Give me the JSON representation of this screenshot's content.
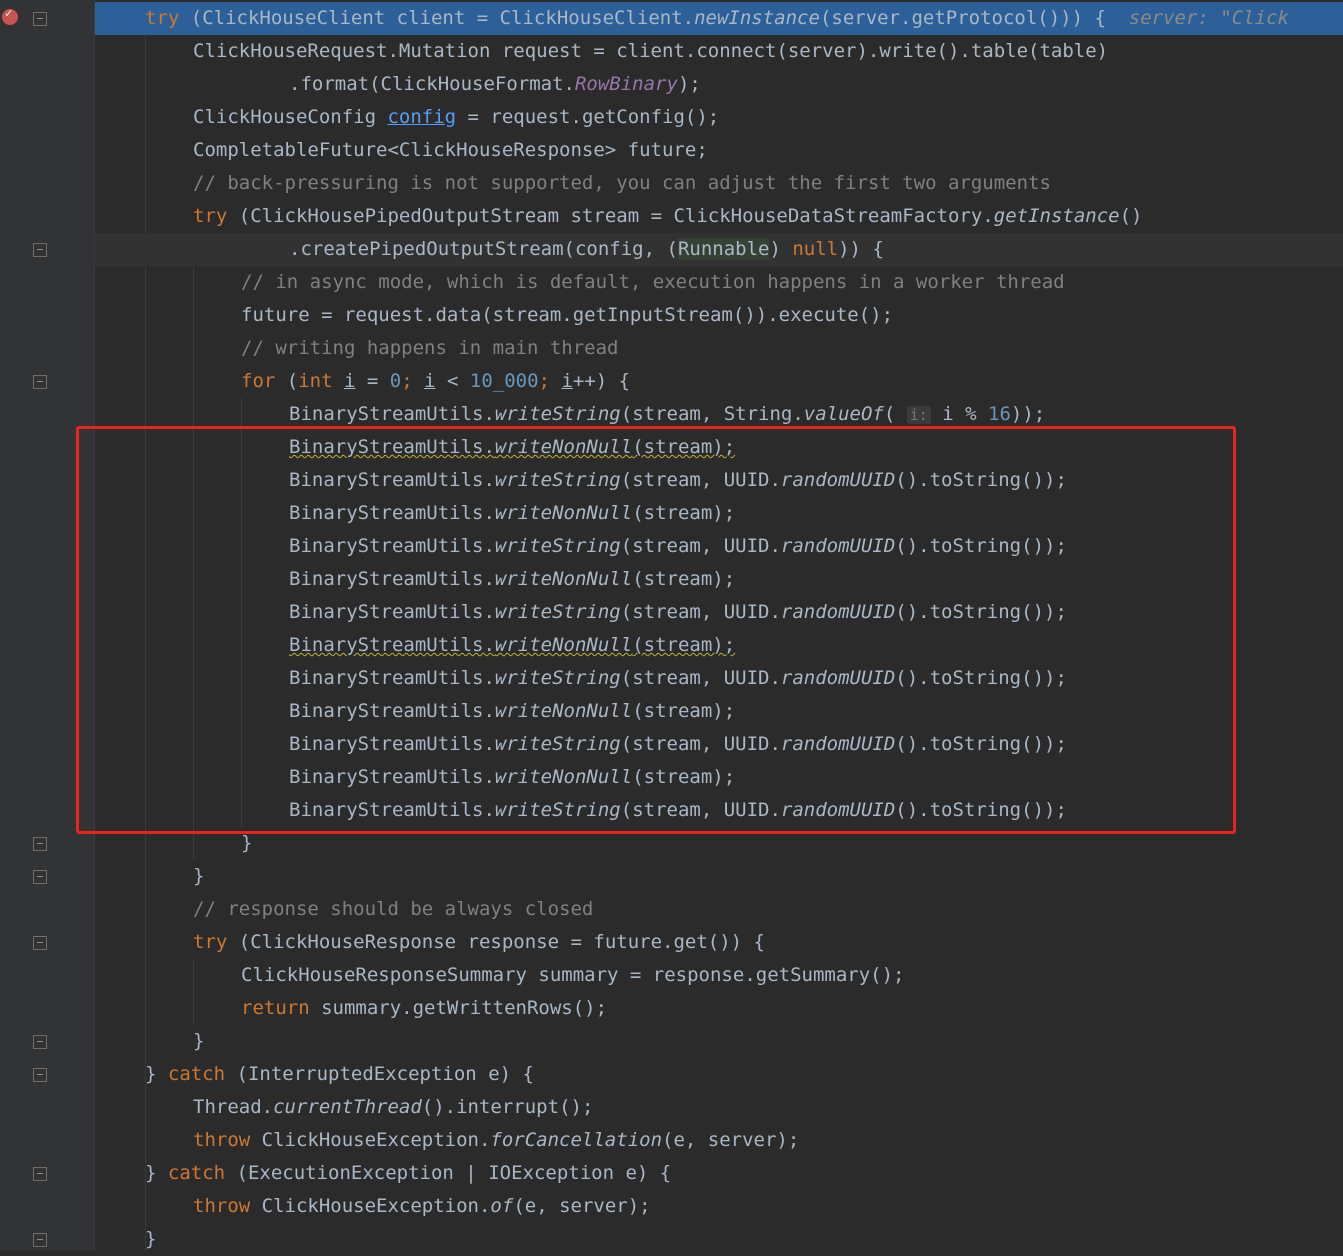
{
  "editor": {
    "highlight_color": "#e8241f",
    "lines": [
      {
        "kw1": "try",
        "p1": " (ClickHouseClient client = ClickHouseClient.",
        "fn1": "newInstance",
        "p2": "(server.getProtocol())) {",
        "hint": "  server: \"Click"
      },
      {
        "p1": "ClickHouseRequest.Mutation request = client.connect(server).write().table(table)"
      },
      {
        "p1": ".format(ClickHouseFormat.",
        "pl": "RowBinary",
        "p2": ");"
      },
      {
        "p1": "ClickHouseConfig ",
        "var": "config",
        "p2": " = request.getConfig();"
      },
      {
        "p1": "CompletableFuture<ClickHouseResponse> future;"
      },
      {
        "cm": "// back-pressuring is not supported, you can adjust the first two arguments"
      },
      {
        "kw1": "try",
        "p1": " (ClickHousePipedOutputStream stream = ClickHouseDataStreamFactory.",
        "fn1": "getInstance",
        "p2": "()"
      },
      {
        "p1": ".createPipedOutputStream(config, (",
        "sel": "Runnable",
        "p2": ") ",
        "kw2": "null",
        "p3": ")) {"
      },
      {
        "cm": "// in async mode, which is default, execution happens in a worker thread"
      },
      {
        "p1": "future = request.data(stream.getInputStream()).execute();"
      },
      {
        "cm": "// writing happens in main thread"
      },
      {
        "kw1": "for",
        "p1": " (",
        "kw2": "int",
        "var": "i",
        "p2": " = ",
        "num1": "0",
        "p3": "; ",
        "var2": "i",
        "p4": " < ",
        "num2": "10_000",
        "p5": "; ",
        "var3": "i",
        "p6": "++) {"
      },
      {
        "p1": "BinaryStreamUtils.",
        "fn1": "writeString",
        "p2": "(stream, String.",
        "fn2": "valueOf",
        "p3": "( ",
        "hintbox": "i:",
        "p4": " i % ",
        "num1": "16",
        "p5": "));"
      },
      {
        "p1": "BinaryStreamUtils.",
        "fn1": "writeNonNull",
        "p2": "(stream);"
      },
      {
        "p1": "BinaryStreamUtils.",
        "fn1": "writeString",
        "p2": "(stream, UUID.",
        "fn2": "randomUUID",
        "p3": "().toString());"
      },
      {
        "p1": "BinaryStreamUtils.",
        "fn1": "writeNonNull",
        "p2": "(stream);"
      },
      {
        "p1": "BinaryStreamUtils.",
        "fn1": "writeString",
        "p2": "(stream, UUID.",
        "fn2": "randomUUID",
        "p3": "().toString());"
      },
      {
        "p1": "BinaryStreamUtils.",
        "fn1": "writeNonNull",
        "p2": "(stream);"
      },
      {
        "p1": "BinaryStreamUtils.",
        "fn1": "writeString",
        "p2": "(stream, UUID.",
        "fn2": "randomUUID",
        "p3": "().toString());"
      },
      {
        "p1": "BinaryStreamUtils.",
        "fn1": "writeNonNull",
        "p2": "(stream);"
      },
      {
        "p1": "BinaryStreamUtils.",
        "fn1": "writeString",
        "p2": "(stream, UUID.",
        "fn2": "randomUUID",
        "p3": "().toString());"
      },
      {
        "p1": "BinaryStreamUtils.",
        "fn1": "writeNonNull",
        "p2": "(stream);"
      },
      {
        "p1": "BinaryStreamUtils.",
        "fn1": "writeString",
        "p2": "(stream, UUID.",
        "fn2": "randomUUID",
        "p3": "().toString());"
      },
      {
        "p1": "BinaryStreamUtils.",
        "fn1": "writeNonNull",
        "p2": "(stream);"
      },
      {
        "p1": "BinaryStreamUtils.",
        "fn1": "writeString",
        "p2": "(stream, UUID.",
        "fn2": "randomUUID",
        "p3": "().toString());"
      },
      {
        "p1": "}"
      },
      {
        "p1": "}"
      },
      {
        "cm": "// response should be always closed"
      },
      {
        "kw1": "try",
        "p1": " (ClickHouseResponse response = future.get()) {"
      },
      {
        "p1": "ClickHouseResponseSummary summary = response.getSummary();"
      },
      {
        "kw1": "return",
        "p1": " summary.getWrittenRows();"
      },
      {
        "p1": "}"
      },
      {
        "p1": "} ",
        "kw1": "catch",
        "p2": " (InterruptedException e) {"
      },
      {
        "p1": "Thread.",
        "fn1": "currentThread",
        "p2": "().interrupt();"
      },
      {
        "kw1": "throw",
        "p1": " ClickHouseException.",
        "fn1": "forCancellation",
        "p2": "(e, server);"
      },
      {
        "p1": "} ",
        "kw1": "catch",
        "p2": " (ExecutionException | IOException e) {"
      },
      {
        "kw1": "throw",
        "p1": " ClickHouseException.",
        "fn1": "of",
        "p2": "(e, server);"
      },
      {
        "p1": "}"
      }
    ]
  }
}
